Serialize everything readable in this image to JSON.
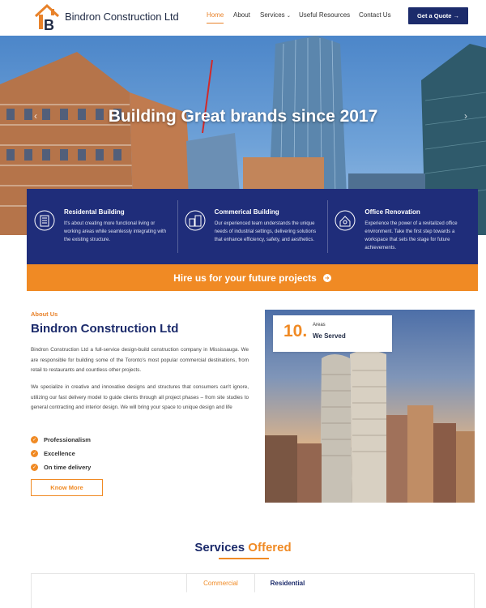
{
  "header": {
    "brand": "Bindron Construction Ltd",
    "nav": [
      {
        "label": "Home",
        "active": true
      },
      {
        "label": "About"
      },
      {
        "label": "Services"
      },
      {
        "label": "Useful Resources"
      },
      {
        "label": "Contact Us"
      }
    ],
    "cta": "Get a Quote →"
  },
  "hero": {
    "title": "Building Great brands since 2017"
  },
  "features": [
    {
      "title": "Residental Building",
      "text": "It's about creating more functional living or working areas while seamlessly integrating with the existing structure.",
      "icon": "building-icon"
    },
    {
      "title": "Commerical Building",
      "text": "Our experienced team understands the unique needs of industrial settings, delivering solutions that enhance efficiency, safety, and aesthetics.",
      "icon": "city-icon"
    },
    {
      "title": "Office Renovation",
      "text": "Experience the power of a revitalized office environment. Take the first step towards a workspace that sets the stage for future achievements.",
      "icon": "renovation-icon"
    }
  ],
  "hire": {
    "label": "Hire us for your future projects"
  },
  "about": {
    "label": "About Us",
    "title": "Bindron Construction Ltd",
    "p1": "Bindron Construction Ltd a full-service design-build construction company in Mississauga. We are responsible for building some of the Toronto's most popular commercial destinations, from retail to restaurants and countless other projects.",
    "p2": "We specialize in creative and innovative designs and structures that consumers can't ignore, utilizing our fast delivery model to guide clients through all project phases – from site studies to general contracting and interior design. We will bring your space to unique design and life",
    "checks": [
      "Professionalism",
      "Excellence",
      "On time delivery"
    ],
    "button": "Know More",
    "stat_number": "10.",
    "stat_sub": "Areas",
    "stat_label": "We Served"
  },
  "services": {
    "title_a": "Services",
    "title_b": "Offered",
    "tabs": [
      "Commercial",
      "Residential"
    ]
  },
  "colors": {
    "navy": "#1c2b6b",
    "orange": "#f08a24"
  }
}
